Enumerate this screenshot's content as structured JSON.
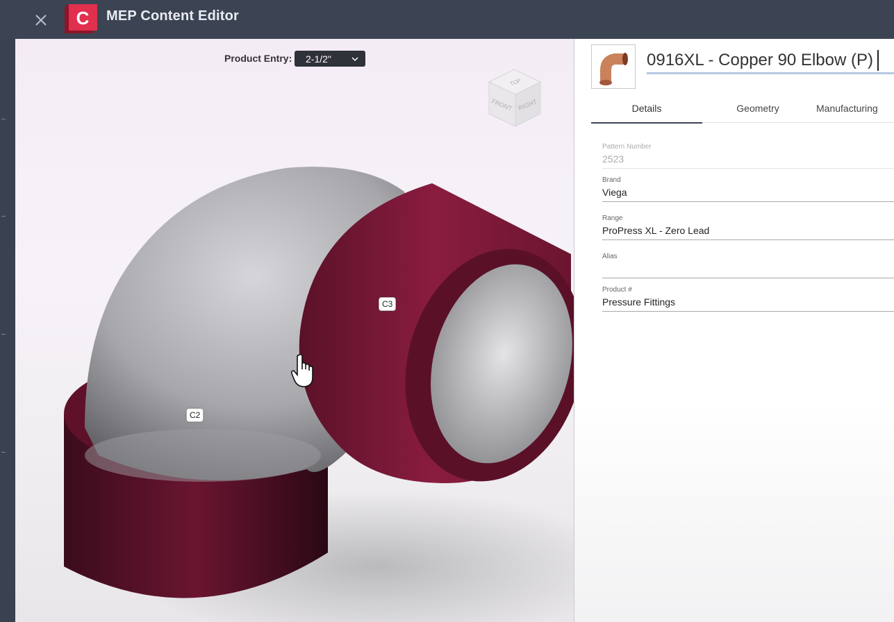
{
  "app": {
    "title": "MEP Content Editor",
    "logo_letter": "C"
  },
  "viewport": {
    "product_entry_label": "Product Entry:",
    "product_entry_value": "2-1/2\"",
    "viewcube": {
      "top": "TOP",
      "front": "FRONT",
      "right": "RIGHT"
    },
    "connectors": [
      "C2",
      "C3"
    ]
  },
  "panel": {
    "title": "0916XL - Copper 90 Elbow (P)",
    "tabs": [
      "Details",
      "Geometry",
      "Manufacturing"
    ],
    "active_tab": "Details",
    "fields": [
      {
        "label": "Pattern Number",
        "value": "2523",
        "disabled": true
      },
      {
        "label": "Brand",
        "value": "Viega",
        "disabled": false
      },
      {
        "label": "Range",
        "value": "ProPress XL - Zero Lead",
        "disabled": false
      },
      {
        "label": "Alias",
        "value": "",
        "disabled": false
      },
      {
        "label": "Product #",
        "value": "Pressure Fittings",
        "disabled": false
      }
    ]
  },
  "colors": {
    "titlebar": "#3c4454",
    "logo": "#c8203c",
    "fitting_body": "#b8b8bc",
    "fitting_socket": "#7a1838"
  }
}
